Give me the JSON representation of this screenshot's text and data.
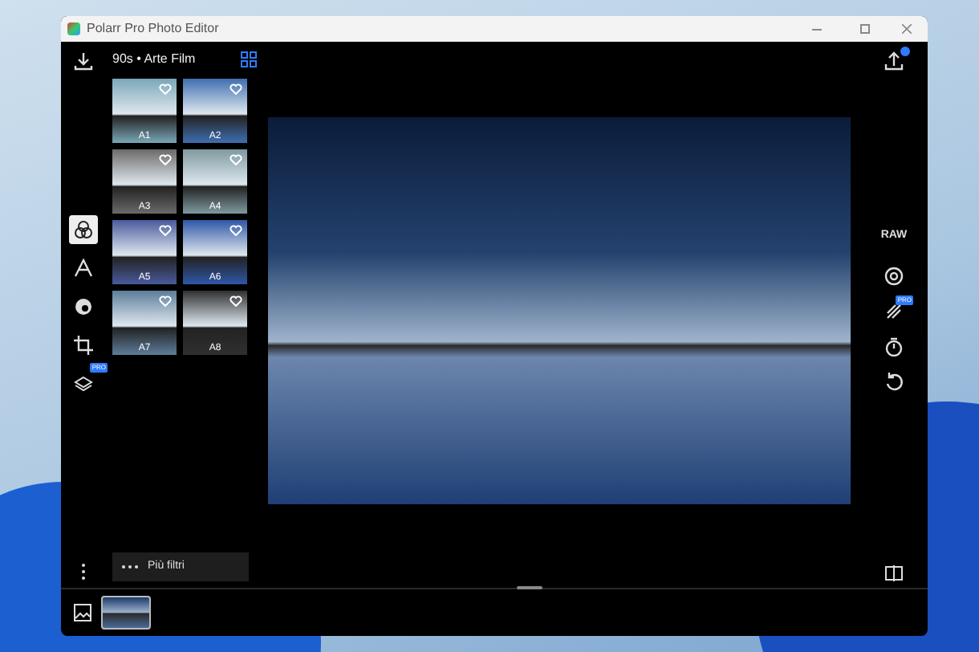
{
  "window": {
    "title": "Polarr Pro Photo Editor"
  },
  "filter_pack": {
    "title": "90s • Arte Film"
  },
  "filters": [
    {
      "label": "A1",
      "color": "#7aa7b8",
      "selected": false
    },
    {
      "label": "A2",
      "color": "#3f6fb0",
      "selected": false
    },
    {
      "label": "A3",
      "color": "#6b6a6a",
      "selected": false
    },
    {
      "label": "A4",
      "color": "#7f9aa0",
      "selected": false
    },
    {
      "label": "A5",
      "color": "#4a5a9c",
      "selected": false
    },
    {
      "label": "A6",
      "color": "#2f57a8",
      "selected": false
    },
    {
      "label": "A7",
      "color": "#5d7d9a",
      "selected": false
    },
    {
      "label": "A8",
      "color": "#303030",
      "selected": false
    }
  ],
  "left_tools": [
    {
      "kind": "filters",
      "selected": true
    },
    {
      "kind": "text",
      "selected": false
    },
    {
      "kind": "face",
      "selected": false
    },
    {
      "kind": "crop",
      "selected": false
    },
    {
      "kind": "layers",
      "selected": false,
      "badge": "PRO"
    }
  ],
  "right_tools": [
    {
      "kind": "raw",
      "label": "RAW"
    },
    {
      "kind": "lens"
    },
    {
      "kind": "brush",
      "badge": "PRO"
    },
    {
      "kind": "timer"
    },
    {
      "kind": "reset"
    }
  ],
  "more_filters": {
    "label": "Più filtri"
  },
  "filmstrip": [
    {
      "selected": true
    }
  ]
}
